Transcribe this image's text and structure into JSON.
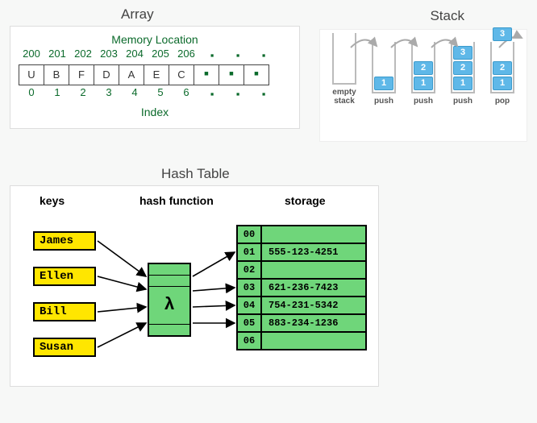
{
  "array": {
    "title": "Array",
    "mem_label": "Memory Location",
    "index_label": "Index",
    "mem": [
      "200",
      "201",
      "202",
      "203",
      "204",
      "205",
      "206"
    ],
    "cells": [
      "U",
      "B",
      "F",
      "D",
      "A",
      "E",
      "C"
    ],
    "idx": [
      "0",
      "1",
      "2",
      "3",
      "4",
      "5",
      "6"
    ]
  },
  "stack": {
    "title": "Stack",
    "labels": [
      "empty\nstack",
      "push",
      "push",
      "push",
      "pop"
    ],
    "cols": [
      [],
      [
        "1"
      ],
      [
        "1",
        "2"
      ],
      [
        "1",
        "2",
        "3"
      ],
      [
        "1",
        "2"
      ]
    ],
    "popped": "3"
  },
  "hash": {
    "title": "Hash Table",
    "headers": {
      "keys": "keys",
      "func": "hash function",
      "storage": "storage"
    },
    "lambda": "λ",
    "keys": [
      "James",
      "Ellen",
      "Bill",
      "Susan"
    ],
    "storage": [
      {
        "idx": "00",
        "val": ""
      },
      {
        "idx": "01",
        "val": "555-123-4251"
      },
      {
        "idx": "02",
        "val": ""
      },
      {
        "idx": "03",
        "val": "621-236-7423"
      },
      {
        "idx": "04",
        "val": "754-231-5342"
      },
      {
        "idx": "05",
        "val": "883-234-1236"
      },
      {
        "idx": "06",
        "val": ""
      }
    ]
  }
}
